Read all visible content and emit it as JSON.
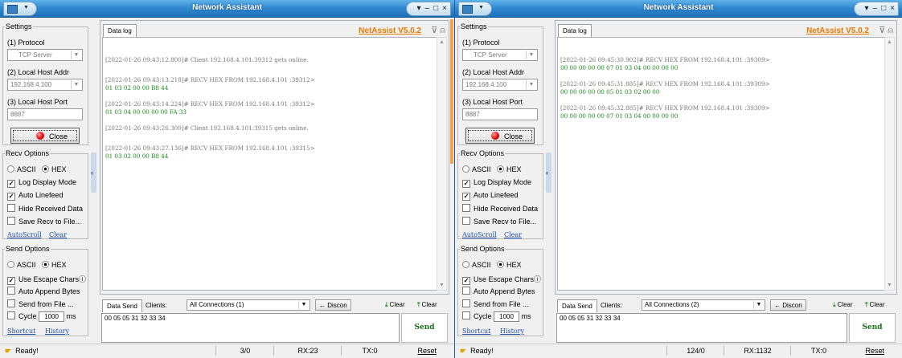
{
  "windows": [
    {
      "title": "Network Assistant",
      "window_controls": [
        "▾",
        "–",
        "□",
        "×"
      ],
      "settings": {
        "legend": "Settings",
        "protocol_label": "(1) Protocol",
        "protocol_value": "TCP Server",
        "host_addr_label": "(2) Local Host Addr",
        "host_addr_value": "192.168.4.100",
        "host_port_label": "(3) Local Host Port",
        "host_port_value": "8887",
        "close_label": "Close"
      },
      "recv_options": {
        "legend": "Recv Options",
        "ascii_label": "ASCII",
        "hex_label": "HEX",
        "log_display_mode": "Log Display Mode",
        "auto_linefeed": "Auto Linefeed",
        "hide_received": "Hide Received Data",
        "save_recv": "Save Recv to File...",
        "autoscroll": "AutoScroll",
        "clear": "Clear"
      },
      "send_options": {
        "legend": "Send Options",
        "ascii_label": "ASCII",
        "hex_label": "HEX",
        "escape_chars": "Use Escape Chars",
        "info_glyph": "ⓘ",
        "auto_append": "Auto Append Bytes",
        "send_from_file": "Send from File ...",
        "cycle_label": "Cycle",
        "cycle_value": "1000",
        "cycle_unit": "ms",
        "shortcut": "Shortcut",
        "history": "History"
      },
      "datalog": {
        "tab": "Data log",
        "brand": "NetAssist V5.0.2",
        "lines": [
          {
            "ts": "[2022-01-26 09:43:12.800]# Client 192.168.4.101:39312 gets online.",
            "hex": ""
          },
          {
            "ts": "[2022-01-26 09:43:13.218]# RECV HEX FROM 192.168.4.101 :39312>",
            "hex": "01 03 02 00 00 B8 44"
          },
          {
            "ts": "[2022-01-26 09:43:14.224]# RECV HEX FROM 192.168.4.101 :39312>",
            "hex": "01 03 04 00 00 00 00 FA 33"
          },
          {
            "ts": "[2022-01-26 09:43:26.300]# Client 192.168.4.101:39315 gets online.",
            "hex": ""
          },
          {
            "ts": "[2022-01-26 09:43:27.136]# RECV HEX FROM 192.168.4.101 :39315>",
            "hex": "01 03 02 00 00 B8 44"
          }
        ]
      },
      "data_send": {
        "tab": "Data Send",
        "clients_label": "Clients:",
        "connections": "All Connections (1)",
        "discon": "Discon",
        "clear1": "Clear",
        "clear2": "Clear",
        "payload": "00 05 05 31 32 33 34",
        "send": "Send"
      },
      "status": {
        "ready": "Ready!",
        "count": "3/0",
        "rx": "RX:23",
        "tx": "TX:0",
        "reset": "Reset"
      }
    },
    {
      "title": "Network Assistant",
      "window_controls": [
        "▾",
        "–",
        "□",
        "×"
      ],
      "settings": {
        "legend": "Settings",
        "protocol_label": "(1) Protocol",
        "protocol_value": "TCP Server",
        "host_addr_label": "(2) Local Host Addr",
        "host_addr_value": "192.168.4.100",
        "host_port_label": "(3) Local Host Port",
        "host_port_value": "8887",
        "close_label": "Close"
      },
      "recv_options": {
        "legend": "Recv Options",
        "ascii_label": "ASCII",
        "hex_label": "HEX",
        "log_display_mode": "Log Display Mode",
        "auto_linefeed": "Auto Linefeed",
        "hide_received": "Hide Received Data",
        "save_recv": "Save Recv to File...",
        "autoscroll": "AutoScroll",
        "clear": "Clear"
      },
      "send_options": {
        "legend": "Send Options",
        "ascii_label": "ASCII",
        "hex_label": "HEX",
        "escape_chars": "Use Escape Chars",
        "info_glyph": "ⓘ",
        "auto_append": "Auto Append Bytes",
        "send_from_file": "Send from File ...",
        "cycle_label": "Cycle",
        "cycle_value": "1000",
        "cycle_unit": "ms",
        "shortcut": "Shortcut",
        "history": "History"
      },
      "datalog": {
        "tab": "Data log",
        "brand": "NetAssist V5.0.2",
        "lines": [
          {
            "ts": "[2022-01-26 09:45:30.902]# RECV HEX FROM 192.168.4.101 :39309>",
            "hex": "00 00 00 00 00 07 01 03 04 00 00 00 00"
          },
          {
            "ts": "[2022-01-26 09:45:31.885]# RECV HEX FROM 192.168.4.101 :39309>",
            "hex": "00 00 00 00 00 05 01 03 02 00 00"
          },
          {
            "ts": "[2022-01-26 09:45:32.885]# RECV HEX FROM 192.168.4.101 :39309>",
            "hex": "00 00 00 00 00 07 01 03 04 00 00 00 00"
          }
        ]
      },
      "data_send": {
        "tab": "Data Send",
        "clients_label": "Clients:",
        "connections": "All Connections (2)",
        "discon": "Discon",
        "clear1": "Clear",
        "clear2": "Clear",
        "payload": "00 05 05 31 32 33 34",
        "send": "Send"
      },
      "status": {
        "ready": "Ready!",
        "count": "124/0",
        "rx": "RX:1132",
        "tx": "TX:0",
        "reset": "Reset"
      }
    }
  ],
  "colors": {
    "titlebar": "#2f87cf",
    "brand": "#e07a00",
    "hex_text": "#1a8a1a",
    "timestamp_text": "#777777",
    "link": "#1f4fa8",
    "close_indicator": "#e00000"
  }
}
